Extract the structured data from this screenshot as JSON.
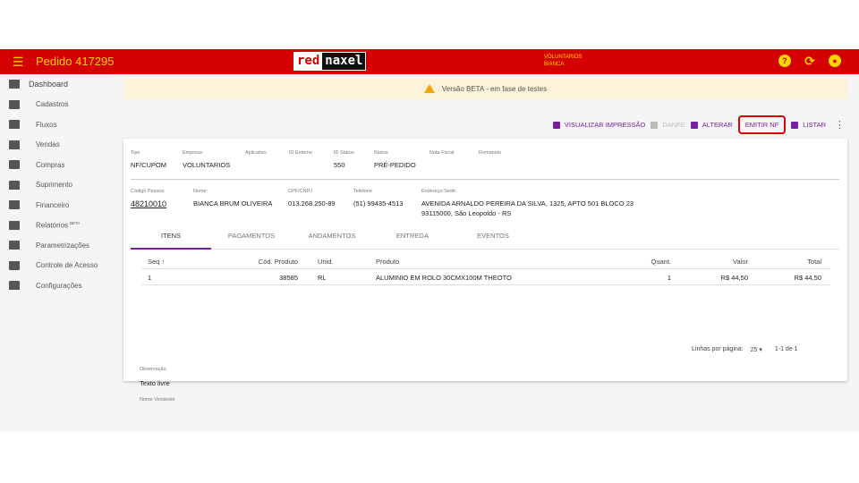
{
  "header": {
    "title": "Pedido 417295",
    "logo_left": "red",
    "logo_right": "naxel",
    "user_line1": "VOLUNTARIOS",
    "user_line2": "BIANCA"
  },
  "sidebar": {
    "items": [
      {
        "label": "Dashboard",
        "icon": "dashboard-icon"
      },
      {
        "label": "Cadastros",
        "icon": "folder-icon"
      },
      {
        "label": "Fluxos",
        "icon": "columns-icon"
      },
      {
        "label": "Vendas",
        "icon": "cart-icon"
      },
      {
        "label": "Compras",
        "icon": "store-icon"
      },
      {
        "label": "Suprimento",
        "icon": "supply-icon"
      },
      {
        "label": "Financeiro",
        "icon": "dollar-icon"
      },
      {
        "label": "Relatórios",
        "icon": "print-icon",
        "badge": "BETA"
      },
      {
        "label": "Parametrizações",
        "icon": "sliders-icon"
      },
      {
        "label": "Controle de Acesso",
        "icon": "shield-icon"
      },
      {
        "label": "Configurações",
        "icon": "gear-icon"
      }
    ]
  },
  "banner": {
    "text": "Versão BETA - em fase de testes"
  },
  "actions": {
    "visualizar": "VISUALIZAR IMPRESSÃO",
    "danfe": "DANFE",
    "alterar": "ALTERAR",
    "emitir": "EMITIR NF",
    "listar": "LISTAR"
  },
  "order": {
    "tipo_label": "Tipo",
    "tipo": "NF/CUPOM",
    "empresa_label": "Empresa",
    "empresa": "VOLUNTARIOS",
    "aplicativo_label": "Aplicativo",
    "idexterno_label": "ID Externo",
    "idstatus_label": "ID Status",
    "idstatus": "550",
    "status_label": "Status",
    "status": "PRÉ-PEDIDO",
    "nota_label": "Nota Fiscal",
    "romaneio_label": "Romaneio",
    "codigo_label": "Código Pessoa",
    "codigo": "48210010",
    "nome_label": "Nome:",
    "nome": "BIANCA BRUM OLIVEIRA",
    "cpf_label": "CPF/CNPJ",
    "cpf": "013.268.250-89",
    "telefone_label": "Telefone",
    "telefone": "(51) 99435-4513",
    "endereco_label": "Endereço Sede:",
    "endereco_line1": "AVENIDA ARNALDO PEREIRA DA SILVA, 1325, APTO 501 BLOCO 23",
    "endereco_line2": "93115000, São Leopoldo - RS"
  },
  "tabs": [
    "ITENS",
    "PAGAMENTOS",
    "ANDAMENTOS",
    "ENTREGA",
    "EVENTOS"
  ],
  "table": {
    "headers": {
      "seq": "Seq",
      "sort": "↑",
      "cod": "Cód. Produto",
      "unid": "Unid.",
      "produto": "Produto",
      "quant": "Quant.",
      "valor": "Valor",
      "total": "Total"
    },
    "rows": [
      {
        "seq": "1",
        "cod": "38585",
        "unid": "RL",
        "produto": "ALUMINIO EM ROLO 30CMX100M THEOTO",
        "quant": "1",
        "valor": "R$ 44,50",
        "total": "R$ 44,50"
      }
    ]
  },
  "pagination": {
    "label": "Linhas por página:",
    "size": "25",
    "range": "1-1 de 1"
  },
  "footer": {
    "obs_label": "Observação",
    "obs_value": "Texto livre",
    "vendedor_label": "Nome Vendedor"
  }
}
